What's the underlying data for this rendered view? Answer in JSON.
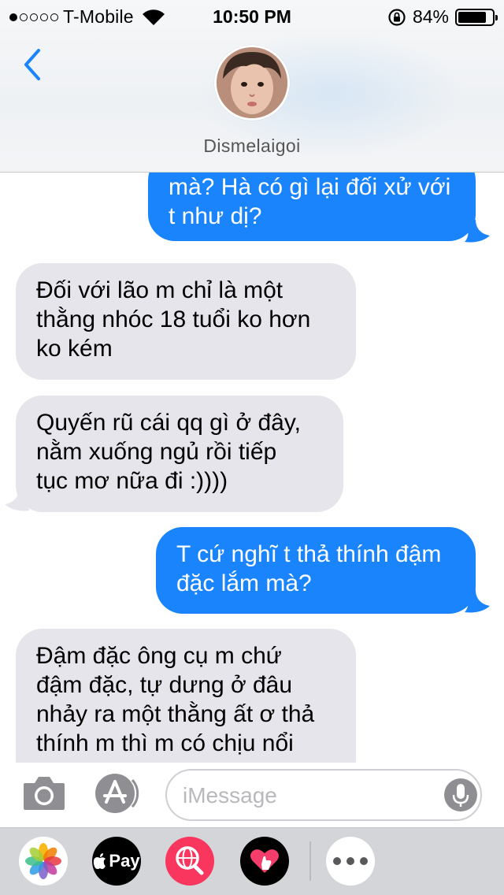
{
  "status_bar": {
    "carrier": "T-Mobile",
    "signal_bars_filled": 1,
    "signal_bars_total": 5,
    "time": "10:50 PM",
    "battery_percent": "84%",
    "battery_level": 0.84
  },
  "header": {
    "contact_name": "Dismelaigoi"
  },
  "messages": [
    {
      "direction": "out",
      "lines": [
        "mà? Hà có gì lại đối xử với",
        "t như dị?"
      ]
    },
    {
      "direction": "in",
      "lines": [
        "Đối với lão m chỉ là một",
        "thằng nhóc 18 tuổi ko hơn",
        "ko kém"
      ]
    },
    {
      "direction": "in",
      "lines": [
        "Quyến rũ cái qq gì ở đây,",
        "nằm xuống ngủ rồi tiếp",
        "tục mơ nữa đi :))))"
      ]
    },
    {
      "direction": "out",
      "lines": [
        "T cứ nghĩ t thả thính đậm",
        "đặc lắm mà?"
      ]
    },
    {
      "direction": "in",
      "lines": [
        "Đậm đặc ông cụ m chứ",
        "đậm đặc, tự dưng ở đâu",
        "nhảy ra một thằng ất ơ thả",
        "thính m thì m có chịu nổi"
      ]
    }
  ],
  "input": {
    "placeholder": "iMessage",
    "value": ""
  },
  "app_drawer": {
    "apple_pay_label": "Pay",
    "icons": [
      "photos-icon",
      "apple-pay-icon",
      "images-search-icon",
      "digital-touch-icon",
      "more-icon"
    ]
  },
  "colors": {
    "accent": "#1a84fd",
    "outgoing_bubble": "#1a84fd",
    "incoming_bubble": "#e6e5eb",
    "images_app": "#f9365e"
  }
}
